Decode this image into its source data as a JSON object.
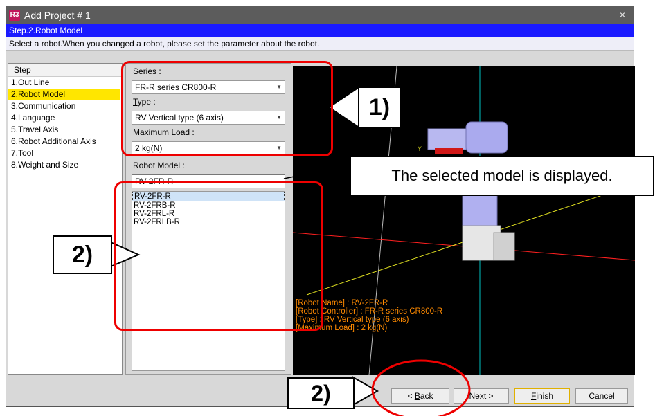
{
  "window": {
    "title": "Add Project # 1",
    "close_glyph": "×",
    "app_icon_text": "R3"
  },
  "step_header": "Step.2.Robot Model",
  "instruction": "Select a robot.When you changed a robot, please set the parameter about the robot.",
  "steps": {
    "header": "Step",
    "items": [
      "1.Out Line",
      "2.Robot Model",
      "3.Communication",
      "4.Language",
      "5.Travel Axis",
      "6.Robot Additional Axis",
      "7.Tool",
      "8.Weight and Size"
    ],
    "selected_index": 1
  },
  "form": {
    "series_label_u": "S",
    "series_label_rest": "eries :",
    "series_value": "FR-R series CR800-R",
    "type_label_u": "T",
    "type_label_rest": "ype :",
    "type_value": "RV Vertical type (6 axis)",
    "maxload_label_u": "M",
    "maxload_label_rest": "aximum Load :",
    "maxload_value": "2 kg(N)",
    "model_label": "Robot Model :",
    "model_value": "RV-2FR-R",
    "models": [
      "RV-2FR-R",
      "RV-2FRB-R",
      "RV-2FRL-R",
      "RV-2FRLB-R"
    ],
    "selected_model_index": 0
  },
  "viewer": {
    "info": [
      "[Robot Name] : RV-2FR-R",
      "[Robot Controller] : FR-R series CR800-R",
      "[Type] : RV Vertical type (6 axis)",
      "[Maximum Load] : 2 kg(N)"
    ],
    "axis_label_y": "Y"
  },
  "buttons": {
    "back_u": "B",
    "back_pre": "< ",
    "back_post": "ack",
    "next": "Next >",
    "finish_u": "F",
    "finish_rest": "inish",
    "cancel": "Cancel"
  },
  "callouts": {
    "one": "1)",
    "two_list": "2)",
    "two_buttons": "2)",
    "message": "The selected model is displayed."
  },
  "colors": {
    "step_bar": "#1a1aff",
    "selected_step": "#ffe600",
    "annotation_red": "#e00000",
    "info_text": "#ff8a00"
  }
}
